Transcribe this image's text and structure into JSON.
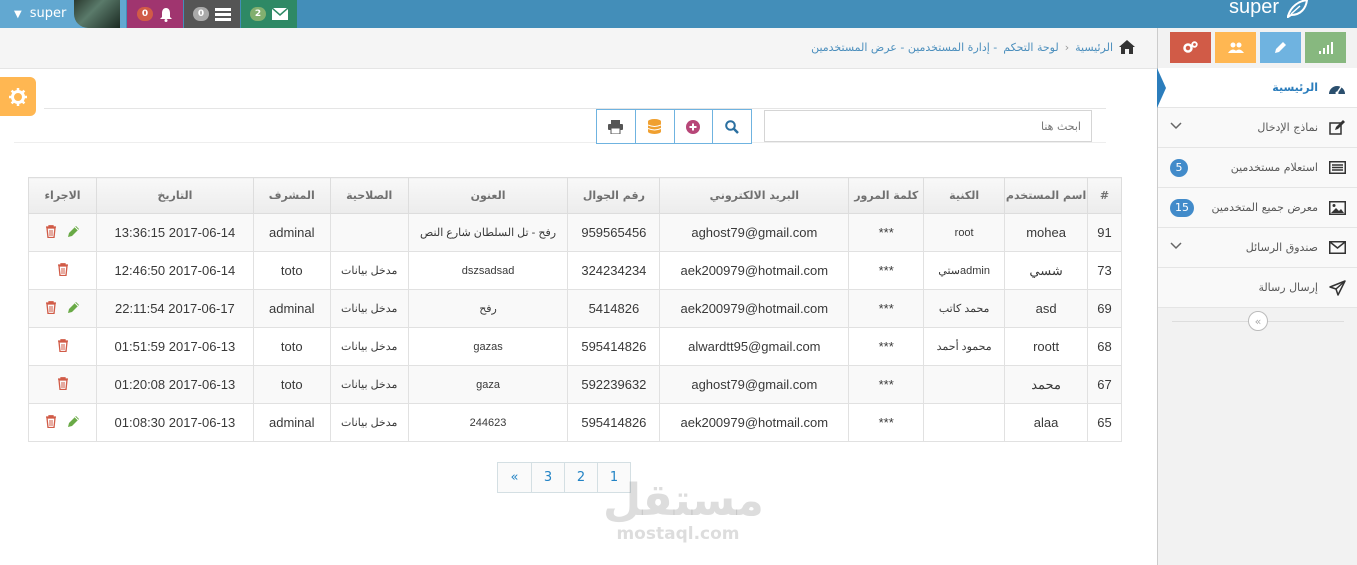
{
  "topbar": {
    "brand": "super",
    "user_name": "super",
    "notifications": [
      {
        "count": "0",
        "icon": "bell-icon"
      },
      {
        "count": "0",
        "icon": "tasks-icon"
      },
      {
        "count": "2",
        "icon": "envelope-icon"
      }
    ]
  },
  "breadcrumb": {
    "home": "الرئيسية",
    "dashboard": "لوحة التحكم",
    "path": "- إدارة المستخدمين - عرض المستخدمين"
  },
  "toolbar": {
    "search_placeholder": "ابحث هنا"
  },
  "table": {
    "headers": [
      "#",
      "اسم المستخدم",
      "الكنية",
      "كلمة المرور",
      "البريد الالكتروني",
      "رقم الجوال",
      "العنون",
      "الصلاحية",
      "المشرف",
      "التاريخ",
      "الاجراء"
    ],
    "rows": [
      {
        "id": "91",
        "username": "mohea",
        "nickname": "root",
        "password": "***",
        "email": "aghost79@gmail.com",
        "mobile": "959565456",
        "address": "رفح - تل السلطان شارع النص",
        "role": "",
        "supervisor": "adminal",
        "date": "2017-06-14 13:36:15",
        "editable": true
      },
      {
        "id": "73",
        "username": "شسي",
        "nickname": "adminستي",
        "password": "***",
        "email": "aek200979@hotmail.com",
        "mobile": "324234234",
        "address": "dszsadsad",
        "role": "مدخل بيانات",
        "supervisor": "toto",
        "date": "2017-06-14 12:46:50",
        "editable": false
      },
      {
        "id": "69",
        "username": "asd",
        "nickname": "محمد كاتب",
        "password": "***",
        "email": "aek200979@hotmail.com",
        "mobile": "5414826",
        "address": "رفح",
        "role": "مدخل بيانات",
        "supervisor": "adminal",
        "date": "2017-06-17 22:11:54",
        "editable": true
      },
      {
        "id": "68",
        "username": "roott",
        "nickname": "محمود أحمد",
        "password": "***",
        "email": "alwardtt95@gmail.com",
        "mobile": "595414826",
        "address": "gazas",
        "role": "مدخل بيانات",
        "supervisor": "toto",
        "date": "2017-06-13 01:51:59",
        "editable": false
      },
      {
        "id": "67",
        "username": "محمد",
        "nickname": "",
        "password": "***",
        "email": "aghost79@gmail.com",
        "mobile": "592239632",
        "address": "gaza",
        "role": "مدخل بيانات",
        "supervisor": "toto",
        "date": "2017-06-13 01:20:08",
        "editable": false
      },
      {
        "id": "65",
        "username": "alaa",
        "nickname": "",
        "password": "***",
        "email": "aek200979@hotmail.com",
        "mobile": "595414826",
        "address": "244623",
        "role": "مدخل بيانات",
        "supervisor": "adminal",
        "date": "2017-06-13 01:08:30",
        "editable": true
      }
    ]
  },
  "pager": [
    "1",
    "2",
    "3",
    "«"
  ],
  "watermark": {
    "arabic": "مستقل",
    "latin": "mostaql.com"
  },
  "sidebar": {
    "shortcut_colors": [
      "#87b87f",
      "#6fb3e0",
      "#ffb752",
      "#d15b47"
    ],
    "items": [
      {
        "label": "الرئيسية",
        "icon": "dashboard-icon",
        "active": true,
        "badge": "",
        "dropdown": false
      },
      {
        "label": "نماذج الإدخال",
        "icon": "edit-icon",
        "active": false,
        "badge": "",
        "dropdown": true
      },
      {
        "label": "استعلام مستخدمين",
        "icon": "list-icon",
        "active": false,
        "badge": "5",
        "dropdown": false
      },
      {
        "label": "معرض جميع المتخدمين",
        "icon": "picture-icon",
        "active": false,
        "badge": "15",
        "dropdown": false
      },
      {
        "label": "صندوق الرسائل",
        "icon": "envelope-icon",
        "active": false,
        "badge": "",
        "dropdown": true
      },
      {
        "label": "إرسال رسالة",
        "icon": "send-icon",
        "active": false,
        "badge": "",
        "dropdown": false
      }
    ]
  }
}
